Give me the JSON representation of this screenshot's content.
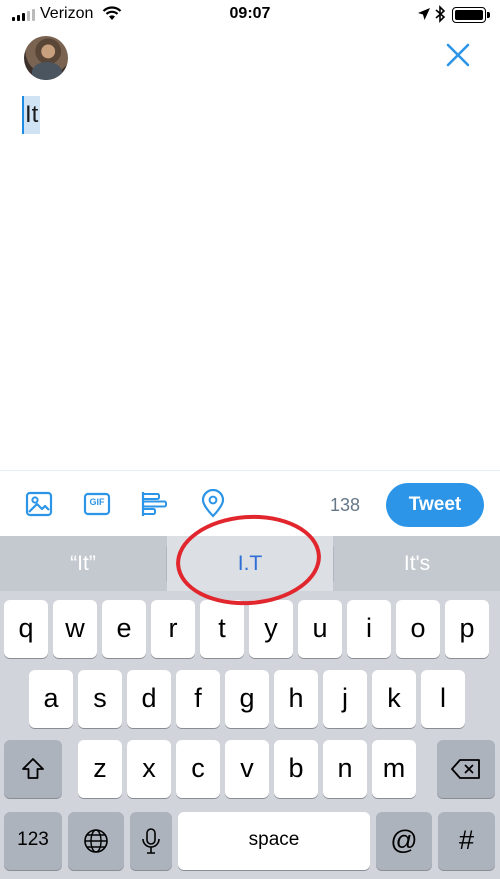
{
  "status_bar": {
    "carrier": "Verizon",
    "time": "09:07"
  },
  "compose": {
    "text": "It",
    "close_icon": "close-icon",
    "avatar": "user-avatar"
  },
  "toolbar": {
    "icons": [
      "image-icon",
      "gif-icon",
      "poll-icon",
      "location-pin-icon"
    ],
    "gif_label": "GIF",
    "char_count": "138",
    "tweet_label": "Tweet"
  },
  "keyboard": {
    "suggestions": [
      "“It”",
      "I.T",
      "It's"
    ],
    "row1": [
      "q",
      "w",
      "e",
      "r",
      "t",
      "y",
      "u",
      "i",
      "o",
      "p"
    ],
    "row2": [
      "a",
      "s",
      "d",
      "f",
      "g",
      "h",
      "j",
      "k",
      "l"
    ],
    "row3": [
      "z",
      "x",
      "c",
      "v",
      "b",
      "n",
      "m"
    ],
    "numbers_label": "123",
    "space_label": "space",
    "at_label": "@",
    "hash_label": "#"
  },
  "colors": {
    "accent": "#2d95e7",
    "annotation": "#e1262d"
  }
}
